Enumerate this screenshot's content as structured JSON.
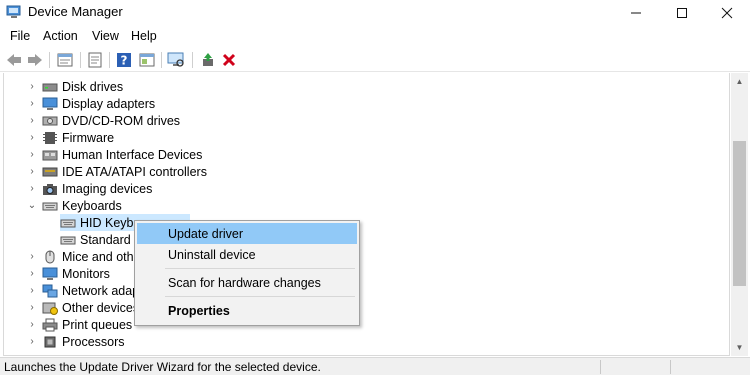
{
  "window": {
    "title": "Device Manager",
    "controls": [
      "—",
      "☐",
      "✕"
    ]
  },
  "menu": [
    "File",
    "Action",
    "View",
    "Help"
  ],
  "toolbar": {
    "buttons": [
      "back-icon",
      "forward-icon",
      "properties-icon",
      "show-hidden-icon",
      "help-icon",
      "view-icon",
      "scan-hardware-icon",
      "update-driver-icon",
      "uninstall-icon"
    ]
  },
  "tree": {
    "items": [
      {
        "label": "Disk drives",
        "icon": "disk-drive-icon",
        "expanded": false
      },
      {
        "label": "Display adapters",
        "icon": "display-adapter-icon",
        "expanded": false
      },
      {
        "label": "DVD/CD-ROM drives",
        "icon": "dvd-drive-icon",
        "expanded": false
      },
      {
        "label": "Firmware",
        "icon": "firmware-icon",
        "expanded": false
      },
      {
        "label": "Human Interface Devices",
        "icon": "hid-icon",
        "expanded": false
      },
      {
        "label": "IDE ATA/ATAPI controllers",
        "icon": "ide-controller-icon",
        "expanded": false
      },
      {
        "label": "Imaging devices",
        "icon": "camera-icon",
        "expanded": false
      },
      {
        "label": "Keyboards",
        "icon": "keyboard-icon",
        "expanded": true
      },
      {
        "label": "HID Keybo",
        "icon": "keyboard-icon",
        "child": true,
        "selected": true
      },
      {
        "label": "Standard P",
        "icon": "keyboard-icon",
        "child": true
      },
      {
        "label": "Mice and othe",
        "icon": "mouse-icon",
        "expanded": false
      },
      {
        "label": "Monitors",
        "icon": "monitor-icon",
        "expanded": false
      },
      {
        "label": "Network adapt",
        "icon": "network-icon",
        "expanded": false
      },
      {
        "label": "Other devices",
        "icon": "other-devices-icon",
        "expanded": false
      },
      {
        "label": "Print queues",
        "icon": "printer-icon",
        "expanded": false
      },
      {
        "label": "Processors",
        "icon": "processor-icon",
        "expanded": false
      }
    ]
  },
  "context_menu": {
    "items": [
      {
        "label": "Update driver",
        "highlighted": true
      },
      {
        "label": "Uninstall device"
      },
      {
        "label": "Scan for hardware changes"
      },
      {
        "label": "Properties",
        "bold": true
      }
    ]
  },
  "status": {
    "text": "Launches the Update Driver Wizard for the selected device."
  },
  "colors": {
    "selection": "#cce8ff",
    "menu_highlight": "#91c9f7",
    "uninstall_red": "#d0021b"
  }
}
